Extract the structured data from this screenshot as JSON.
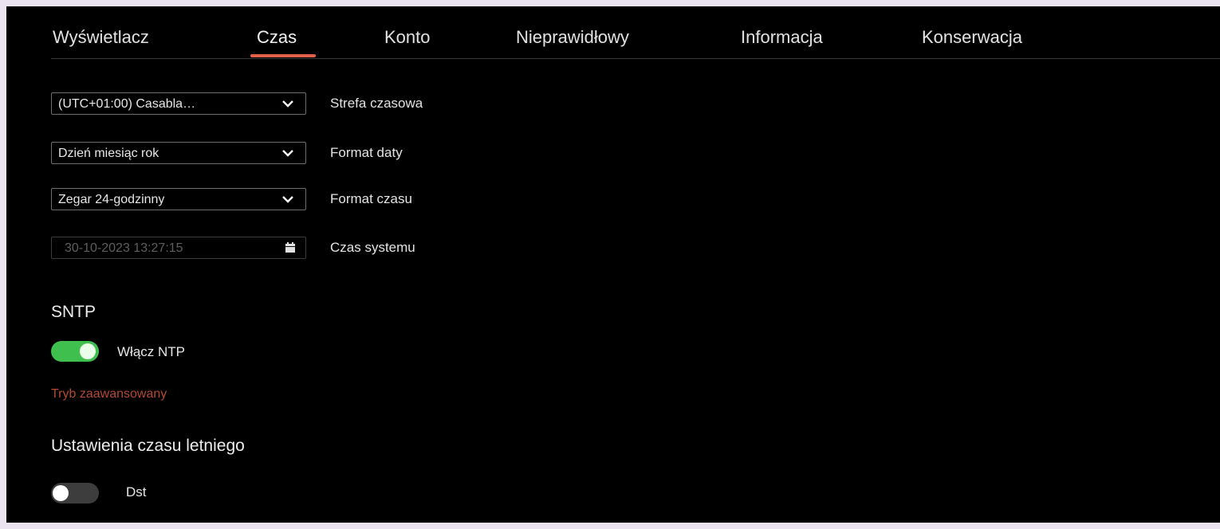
{
  "tabs": [
    {
      "label": "Wyświetlacz"
    },
    {
      "label": "Czas"
    },
    {
      "label": "Konto"
    },
    {
      "label": "Nieprawidłowy"
    },
    {
      "label": "Informacja"
    },
    {
      "label": "Konserwacja"
    }
  ],
  "active_tab": "Czas",
  "form": {
    "timezone": {
      "value": "(UTC+01:00) Casabla…",
      "label": "Strefa czasowa"
    },
    "date_format": {
      "value": "Dzień miesiąc rok",
      "label": "Format daty"
    },
    "time_format": {
      "value": "Zegar 24-godzinny",
      "label": "Format czasu"
    },
    "system_time": {
      "value": "30-10-2023 13:27:15",
      "label": "Czas systemu"
    }
  },
  "sntp": {
    "title": "SNTP",
    "enable_label": "Włącz NTP",
    "enabled": true,
    "advanced_link": "Tryb zaawansowany"
  },
  "dst": {
    "title": "Ustawienia czasu letniego",
    "label": "Dst",
    "enabled": false
  },
  "colors": {
    "accent": "#e2604a",
    "toggle_on": "#3fbf4d",
    "link": "#b34a34",
    "background": "#000000"
  },
  "icons": [
    "chevron-down-icon",
    "calendar-icon"
  ]
}
